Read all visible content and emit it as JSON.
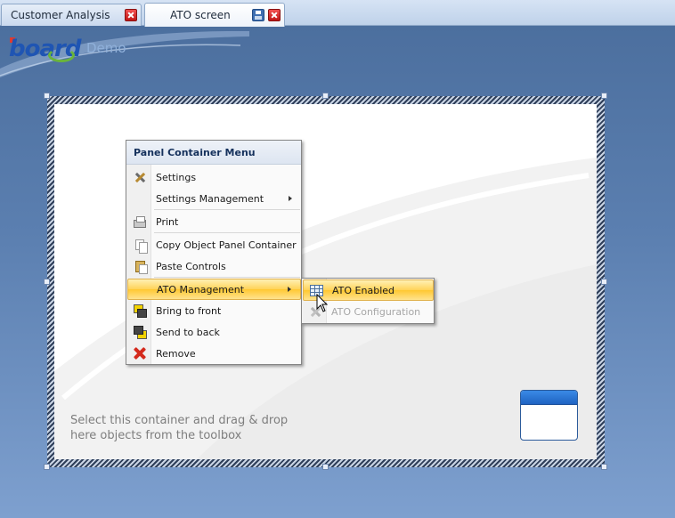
{
  "tabs": [
    {
      "label": "Customer Analysis",
      "active": false
    },
    {
      "label": "ATO screen",
      "active": true
    }
  ],
  "logo": {
    "text": "board",
    "suffix": "Demo"
  },
  "panel": {
    "hint_line1": "Select this container and drag & drop",
    "hint_line2": "here objects from the toolbox"
  },
  "context_menu": {
    "title": "Panel Container Menu",
    "items": [
      {
        "label": "Settings",
        "icon": "settings-icon"
      },
      {
        "label": "Settings Management",
        "icon": null,
        "submenu": true
      },
      {
        "label": "Print",
        "icon": "printer-icon"
      },
      {
        "label": "Copy Object Panel Container",
        "icon": "copy-icon"
      },
      {
        "label": "Paste Controls",
        "icon": "paste-icon"
      },
      {
        "label": "ATO Management",
        "icon": null,
        "submenu": true,
        "highlighted": true
      },
      {
        "label": "Bring to front",
        "icon": "bring-to-front-icon"
      },
      {
        "label": "Send to back",
        "icon": "send-to-back-icon"
      },
      {
        "label": "Remove",
        "icon": "remove-icon"
      }
    ]
  },
  "submenu": {
    "items": [
      {
        "label": "ATO Enabled",
        "icon": "grid-table-icon",
        "highlighted": true
      },
      {
        "label": "ATO Configuration",
        "icon": "configuration-icon",
        "disabled": true
      }
    ]
  },
  "colors": {
    "background_top": "#4a6d9c",
    "background_bottom": "#7ea0cf",
    "highlight": "#ffd358",
    "menu_title": "#15315c"
  }
}
